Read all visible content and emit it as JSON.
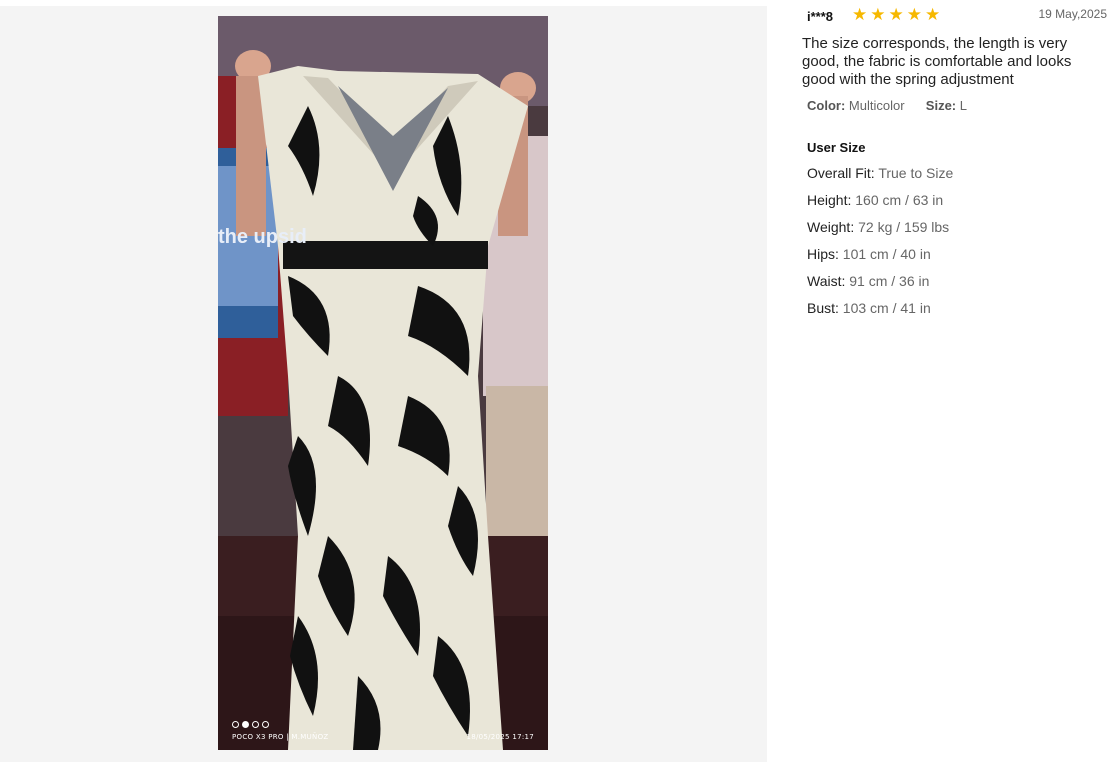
{
  "photo": {
    "tv_text": "the upsid",
    "watermark_left": "POCO X3 PRO | M.MUÑOZ",
    "watermark_right": "18/05/2025  17:17",
    "carousel_dots": 4,
    "active_dot": 1
  },
  "review": {
    "user": "i***8",
    "rating": 5,
    "date": "19 May,2025",
    "comment": "The size corresponds, the length is very good, the fabric is comfortable and looks good with the spring adjustment",
    "color_label": "Color:",
    "color_value": "Multicolor",
    "size_label": "Size:",
    "size_value": "L",
    "user_size_title": "User Size",
    "measurements": [
      {
        "label": "Overall Fit:",
        "value": "True to Size"
      },
      {
        "label": "Height:",
        "value": "160 cm / 63 in"
      },
      {
        "label": "Weight:",
        "value": "72 kg / 159 lbs"
      },
      {
        "label": "Hips:",
        "value": "101 cm / 40 in"
      },
      {
        "label": "Waist:",
        "value": "91 cm / 36 in"
      },
      {
        "label": "Bust:",
        "value": "103 cm / 41 in"
      }
    ]
  },
  "colors": {
    "star": "#f6b800",
    "panel_bg": "#f4f4f4"
  }
}
